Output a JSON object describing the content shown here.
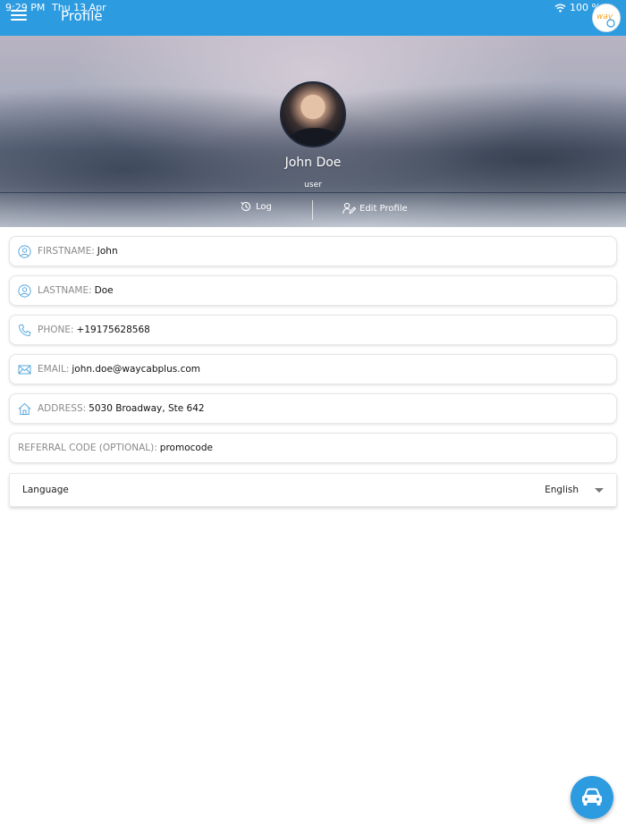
{
  "status_bar": {
    "time": "9:29 PM",
    "date": "Thu 13 Apr",
    "battery": "100 %"
  },
  "header": {
    "title": "Profile",
    "logo_text": "way"
  },
  "profile": {
    "name": "John Doe",
    "role": "user",
    "actions": {
      "log_label": "Log",
      "edit_label": "Edit Profile"
    }
  },
  "fields": [
    {
      "label": "FIRSTNAME:",
      "value": "John",
      "icon": "user-icon"
    },
    {
      "label": "LASTNAME:",
      "value": "Doe",
      "icon": "user-icon"
    },
    {
      "label": "PHONE:",
      "value": "+19175628568",
      "icon": "phone-icon"
    },
    {
      "label": "EMAIL:",
      "value": "john.doe@waycabplus.com",
      "icon": "mail-icon"
    },
    {
      "label": "ADDRESS:",
      "value": "5030 Broadway, Ste 642",
      "icon": "home-icon"
    },
    {
      "label": "REFERRAL CODE (OPTIONAL):",
      "value": "promocode",
      "icon": ""
    }
  ],
  "language": {
    "label": "Language",
    "selected": "English"
  },
  "colors": {
    "primary": "#2d9be0",
    "icon_blue": "#5aa7dd"
  }
}
